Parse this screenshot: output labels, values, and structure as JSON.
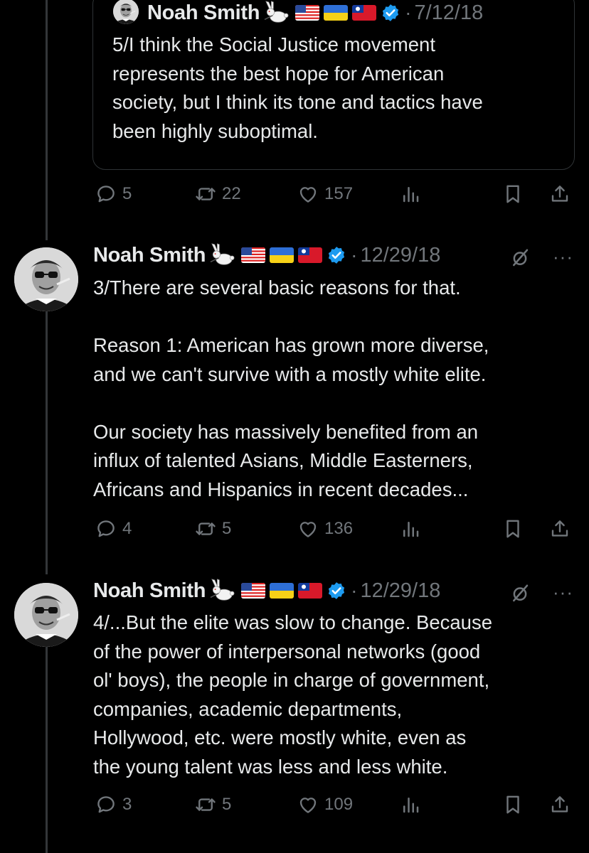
{
  "quoted": {
    "name": "Noah Smith",
    "date": "7/12/18",
    "text": "5/I think the Social Justice movement\nrepresents the best hope for American\nsociety, but I think its tone and tactics have\nbeen highly suboptimal.",
    "replies": "5",
    "reposts": "22",
    "likes": "157"
  },
  "tweets": [
    {
      "name": "Noah Smith",
      "date": "12/29/18",
      "text": "3/There are several basic reasons for that.\n\nReason 1: American has grown more diverse,\nand we can't survive with a mostly white elite.\n\nOur society has massively benefited from an\ninflux of talented Asians, Middle Easterners,\nAfricans and Hispanics in recent decades...",
      "replies": "4",
      "reposts": "5",
      "likes": "136",
      "more": "···"
    },
    {
      "name": "Noah Smith",
      "date": "12/29/18",
      "text": "4/...But the elite was slow to change. Because\nof the power of interpersonal networks (good\nol' boys), the people in charge of government,\ncompanies, academic departments,\nHollywood, etc. were mostly white, even as\nthe young talent was less and less white.",
      "replies": "3",
      "reposts": "5",
      "likes": "109",
      "more": "···"
    }
  ],
  "icons": {
    "emoji": "rabbit-icon",
    "flags": [
      "us-flag-icon",
      "ukraine-flag-icon",
      "taiwan-flag-icon"
    ],
    "verified": "verified-badge-icon",
    "reply": "reply-icon",
    "repost": "repost-icon",
    "like": "heart-icon",
    "views": "views-icon",
    "bookmark": "bookmark-icon",
    "share": "share-icon",
    "grok": "grok-icon"
  },
  "colors": {
    "verified": "#1d9bf0",
    "muted": "#71767b",
    "text": "#e7e9ea"
  }
}
